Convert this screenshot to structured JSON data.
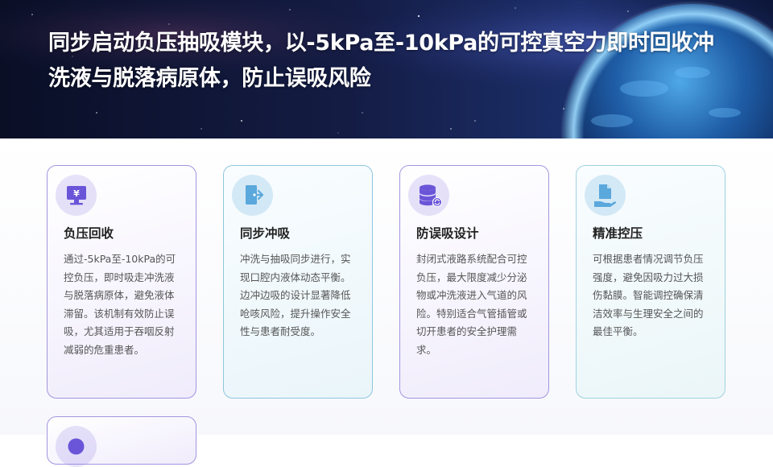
{
  "hero": {
    "title": "同步启动负压抽吸模块，以-5kPa至-10kPa的可控真空力即时回收冲洗液与脱落病原体，防止误吸风险"
  },
  "cards": [
    {
      "icon": "money-monitor-icon",
      "title": "负压回收",
      "body": "通过-5kPa至-10kPa的可控负压，即时吸走冲洗液与脱落病原体，避免液体滞留。该机制有效防止误吸，尤其适用于吞咽反射减弱的危重患者。"
    },
    {
      "icon": "door-exit-icon",
      "title": "同步冲吸",
      "body": "冲洗与抽吸同步进行，实现口腔内液体动态平衡。边冲边吸的设计显著降低呛咳风险，提升操作安全性与患者耐受度。"
    },
    {
      "icon": "database-sync-icon",
      "title": "防误吸设计",
      "body": "封闭式液路系统配合可控负压，最大限度减少分泌物或冲洗液进入气道的风险。特别适合气管插管或切开患者的安全护理需求。"
    },
    {
      "icon": "document-hand-icon",
      "title": "精准控压",
      "body": "可根据患者情况调节负压强度，避免因吸力过大损伤黏膜。智能调控确保清洁效率与生理安全之间的最佳平衡。"
    }
  ],
  "colors": {
    "card_purple_border": "#a395df",
    "card_blue_border": "#8fc6de",
    "icon_purple": "#6a55d8",
    "icon_blue": "#5aa8dc"
  }
}
